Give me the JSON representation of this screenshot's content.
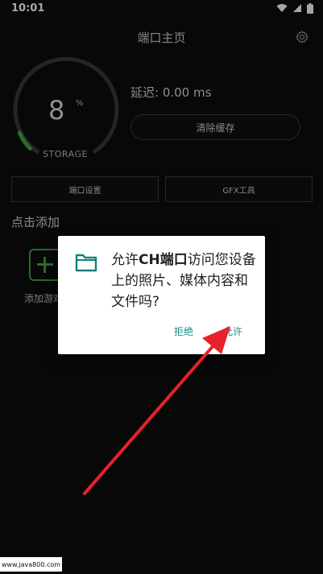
{
  "status_bar": {
    "time": "10:01",
    "icons": [
      "wifi-icon",
      "signal-icon",
      "battery-icon"
    ]
  },
  "header": {
    "title": "端口主页",
    "settings_icon": "gear-icon"
  },
  "storage": {
    "percent_value": "8",
    "percent_unit": "%",
    "label": "STORAGE",
    "fill_percent": 8
  },
  "latency": {
    "text": "延迟: 0.00 ms"
  },
  "buttons": {
    "clear_cache": "清除缓存",
    "port_settings": "端口设置",
    "gfx_tool": "GFX工具"
  },
  "section": {
    "title": "点击添加",
    "add_game_label": "添加游戏"
  },
  "dialog": {
    "text_prefix": "允许",
    "app_name": "CH端口",
    "text_suffix": "访问您设备上的照片、媒体内容和文件吗?",
    "deny": "拒绝",
    "allow": "允许"
  },
  "watermark": "www.java800.com",
  "colors": {
    "accent_green": "#3fa53f",
    "dialog_button": "#1a8a86",
    "annotation_arrow": "#e8212b"
  }
}
